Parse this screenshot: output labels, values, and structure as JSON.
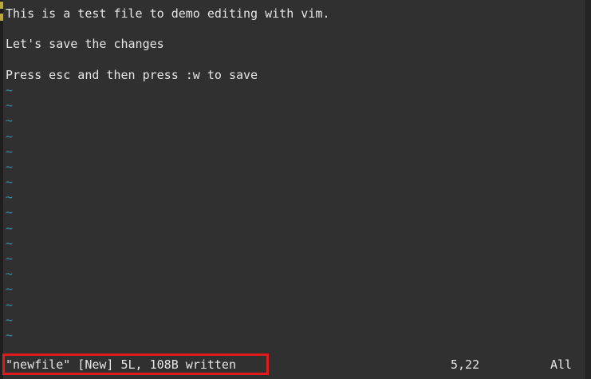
{
  "buffer": {
    "lines": [
      "This is a test file to demo editing with vim.",
      "",
      "Let's save the changes",
      "",
      "Press esc and then press :w to save"
    ],
    "tilde": "~"
  },
  "status": {
    "message": "\"newfile\" [New] 5L, 108B written",
    "position": "5,22",
    "scroll": "All"
  },
  "colors": {
    "background": "#303030",
    "text": "#e6e6e6",
    "tilde": "#3a8aa8",
    "annotation": "#e01b1b"
  }
}
